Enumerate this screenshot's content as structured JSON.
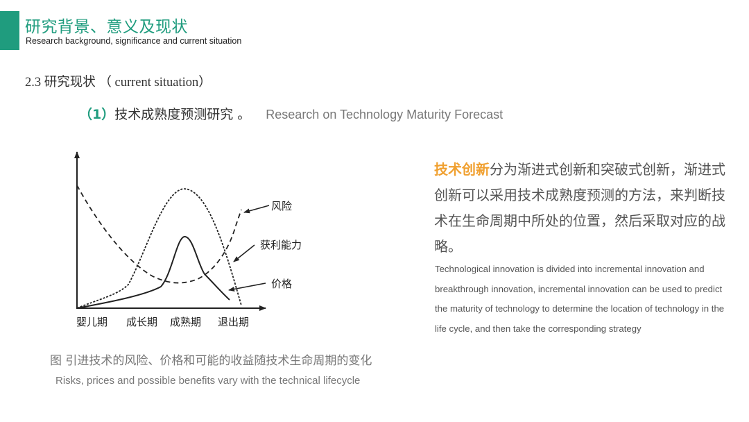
{
  "header": {
    "title": "研究背景、意义及现状",
    "subtitle": "Research background, significance and current situation",
    "accent_color": "#1f9c7e"
  },
  "section": {
    "heading": "2.3 研究现状 （ current situation）"
  },
  "subsection": {
    "number": "（1）",
    "title_cn": "技术成熟度预测研究 。",
    "title_en": "Research on Technology Maturity Forecast"
  },
  "diagram": {
    "x_axis_labels": [
      "婴儿期",
      "成长期",
      "成熟期",
      "退出期"
    ],
    "curves": [
      {
        "name": "风险",
        "style": "dashed",
        "shape": "high at start, falls to minimum in maturity, rises sharply in exit"
      },
      {
        "name": "获利能力",
        "style": "dotted",
        "shape": "low at start, peaks in maturity, falls to zero in exit"
      },
      {
        "name": "价格",
        "style": "solid",
        "shape": "low at start, sharp peak in maturity, declines in exit"
      }
    ],
    "labels": {
      "risk": "风险",
      "profit": "获利能力",
      "price": "价格"
    }
  },
  "caption": {
    "cn": "图  引进技术的风险、价格和可能的收益随技术生命周期的变化",
    "en": "Risks, prices and possible benefits vary with the technical lifecycle"
  },
  "description": {
    "highlight": "技术创新",
    "cn_rest": "分为渐进式创新和突破式创新，渐进式创新可以采用技术成熟度预测的方法，来判断技术在生命周期中所处的位置，然后采取对应的战略。",
    "highlight_color": "#f0a030",
    "en": "Technological innovation is divided into incremental innovation and breakthrough innovation, incremental innovation can be used to predict the maturity of technology to determine the location of technology in the life cycle, and then take the corresponding strategy"
  }
}
